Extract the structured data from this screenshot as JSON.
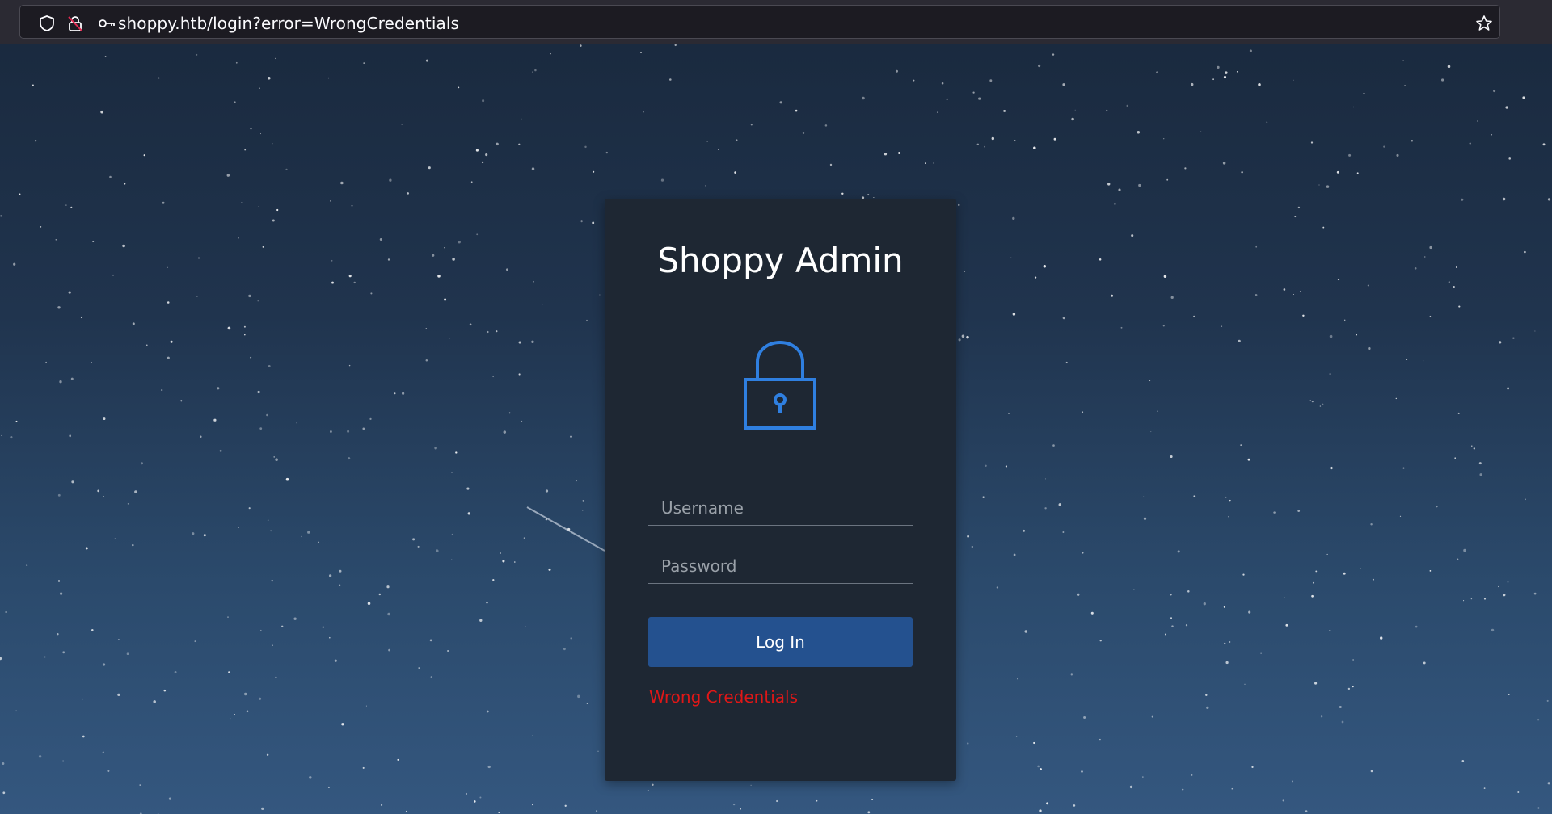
{
  "browser": {
    "url": "shoppy.htb/login?error=WrongCredentials",
    "icons": [
      "shield-icon",
      "insecure-lock-icon",
      "key-icon",
      "bookmark-star-icon"
    ]
  },
  "login": {
    "title": "Shoppy Admin",
    "lock_icon": "padlock-icon",
    "username_placeholder": "Username",
    "password_placeholder": "Password",
    "login_label": "Log In",
    "error_message": "Wrong Credentials"
  },
  "colors": {
    "accent": "#2f7fe0",
    "button": "#24518f",
    "error": "#e01717",
    "card": "#1e2733"
  }
}
